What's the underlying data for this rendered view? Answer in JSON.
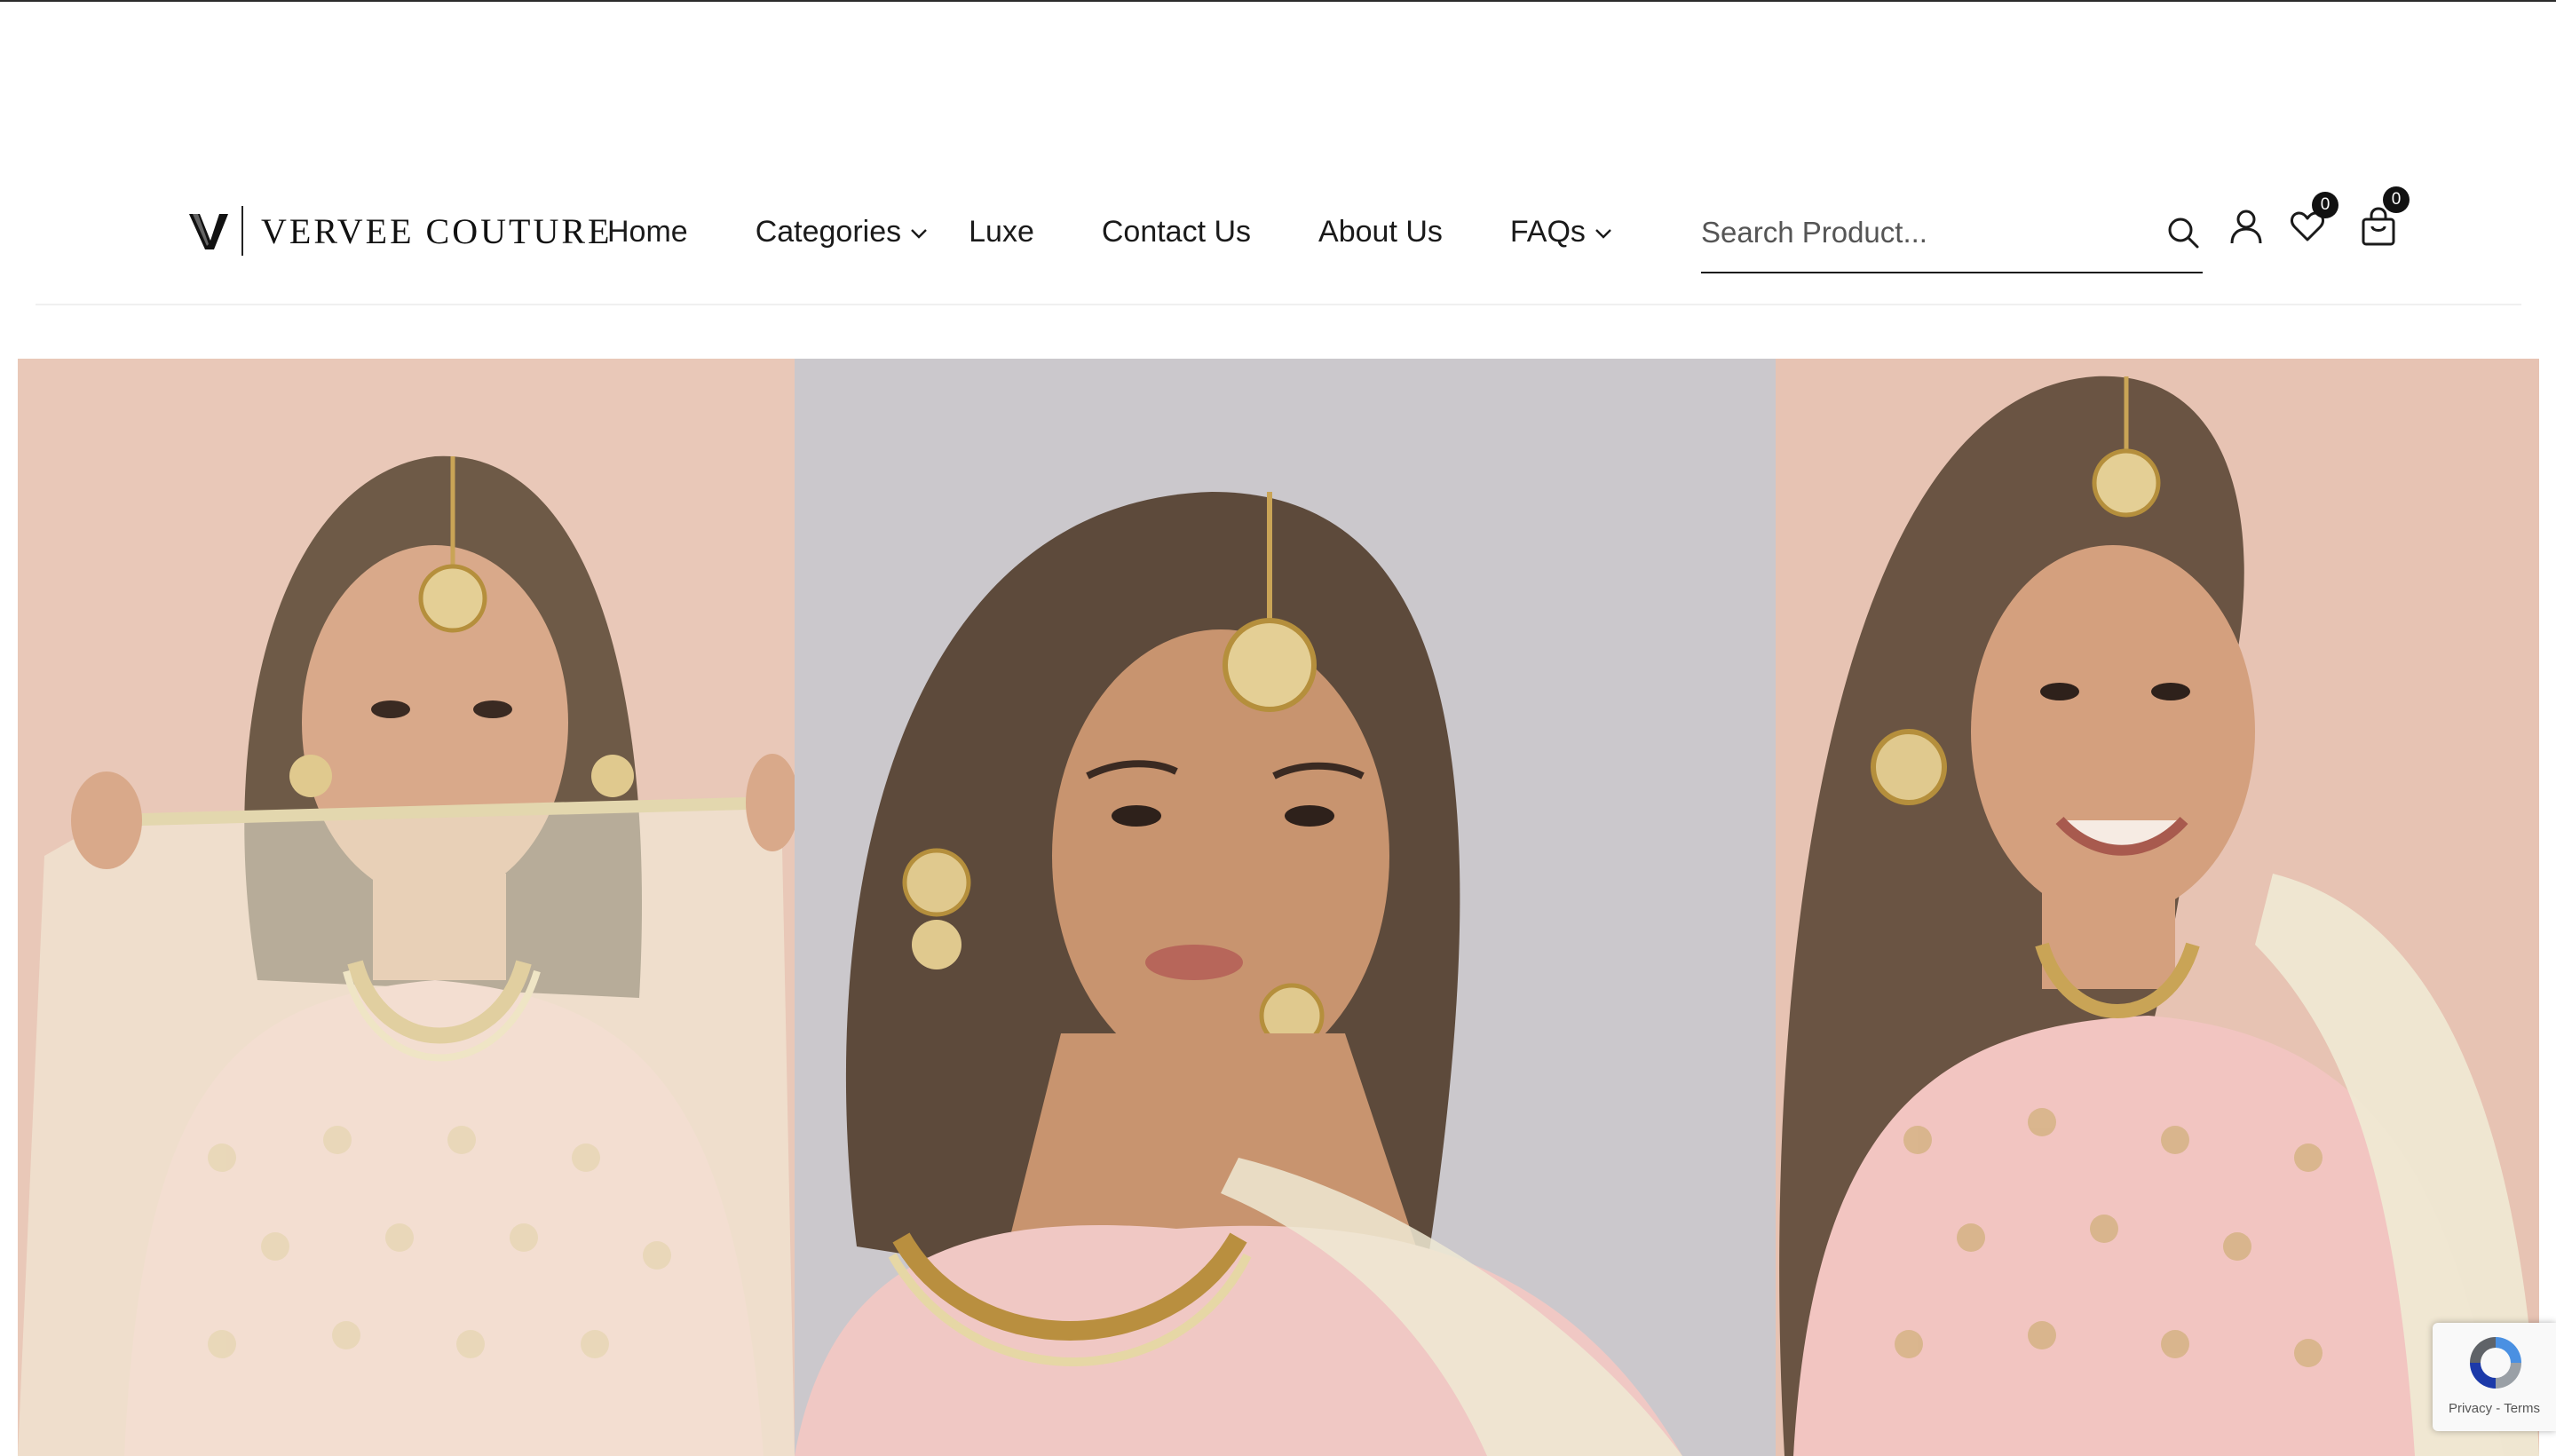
{
  "brand": {
    "name": "VERVEE COUTURE",
    "logo_icon": "v-monogram-icon"
  },
  "nav": {
    "items": [
      {
        "label": "Home",
        "has_dropdown": false
      },
      {
        "label": "Categories",
        "has_dropdown": true
      },
      {
        "label": "Luxe",
        "has_dropdown": false
      },
      {
        "label": "Contact Us",
        "has_dropdown": false
      },
      {
        "label": "About Us",
        "has_dropdown": false
      },
      {
        "label": "FAQs",
        "has_dropdown": true
      }
    ]
  },
  "search": {
    "placeholder": "Search Product...",
    "value": "",
    "icon": "search-icon"
  },
  "header_icons": {
    "account_icon": "user-icon",
    "wishlist_icon": "heart-icon",
    "wishlist_count": "0",
    "cart_icon": "shopping-bag-icon",
    "cart_count": "0"
  },
  "hero": {
    "panels": [
      {
        "description_icon": "model-photo-veil",
        "bg": "#e9c8b8"
      },
      {
        "description_icon": "model-photo-portrait",
        "bg": "#cbc8cc"
      },
      {
        "description_icon": "model-photo-smile",
        "bg": "#e7c3b3"
      }
    ]
  },
  "recaptcha": {
    "privacy": "Privacy",
    "separator": "-",
    "terms": "Terms"
  },
  "colors": {
    "text": "#1a1a1a",
    "badge": "#111111",
    "panel_warm": "#e9c8b8",
    "panel_grey": "#cbc8cc",
    "dress_pink": "#f2c7c3"
  }
}
